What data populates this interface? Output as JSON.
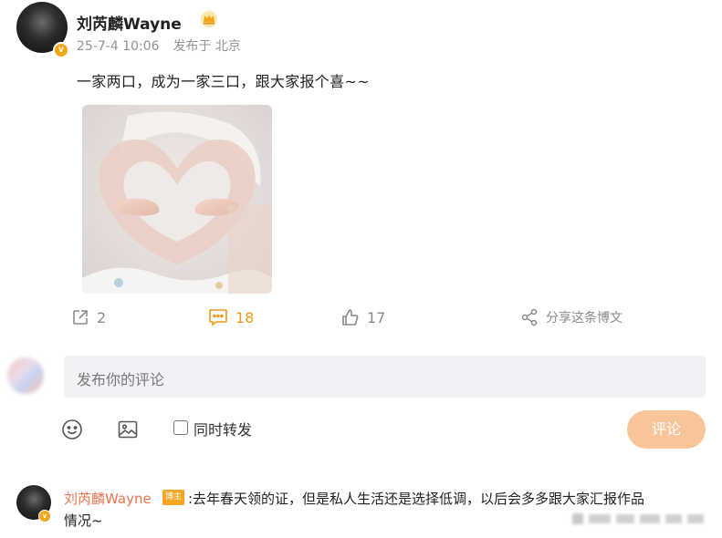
{
  "post": {
    "author": "刘芮麟Wayne",
    "date": "25-7-4 10:06",
    "source": "发布于 北京",
    "text": "一家两口，成为一家三口，跟大家报个喜~~",
    "actions": {
      "repost_count": "2",
      "comment_count": "18",
      "like_count": "17",
      "share_label": "分享这条博文"
    }
  },
  "composer": {
    "placeholder": "发布你的评论",
    "sync_label": "同时转发",
    "submit_label": "评论"
  },
  "reply": {
    "author": "刘芮麟Wayne",
    "author_tag": "博主",
    "text_line1": ":去年春天领的证，但是私人生活还是选择低调，以后会多多跟大家汇报作品",
    "text_line2": "情况~"
  },
  "colors": {
    "accent": "#e89b1b",
    "username_link": "#eb7350",
    "submit_disabled": "#f8c59a",
    "input_bg": "#f1f2f5",
    "verified_badge": "#f2a71b"
  },
  "icons": [
    "crown-icon",
    "verified-badge-icon",
    "repost-icon",
    "comment-icon",
    "like-icon",
    "share-icon",
    "emoji-icon",
    "image-icon"
  ]
}
